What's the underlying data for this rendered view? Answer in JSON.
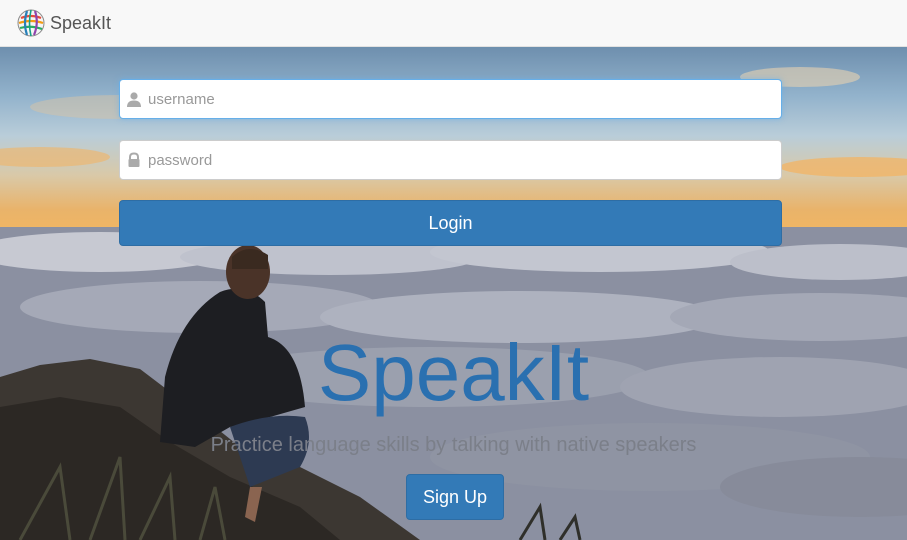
{
  "navbar": {
    "brand_name": "SpeakIt",
    "logo_icon": "globe-logo-icon"
  },
  "login_form": {
    "username_placeholder": "username",
    "password_placeholder": "password",
    "username_icon": "user-icon",
    "password_icon": "lock-icon",
    "login_label": "Login"
  },
  "hero": {
    "title": "SpeakIt",
    "tagline": "Practice language skills by talking with native speakers",
    "signup_label": "Sign Up"
  },
  "colors": {
    "primary": "#337ab7",
    "title": "#2a70b0",
    "navbar_bg": "#f8f8f8"
  }
}
